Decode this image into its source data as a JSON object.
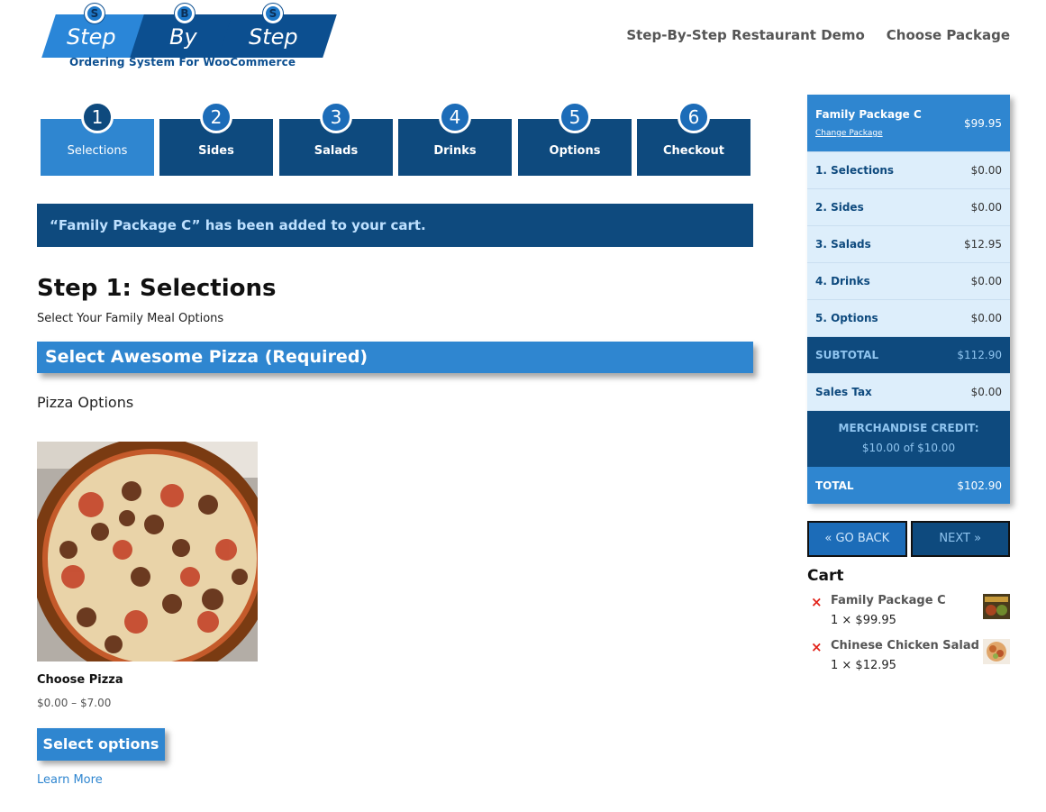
{
  "logo": {
    "badges": [
      "S",
      "B",
      "S"
    ],
    "words": [
      "Step",
      "By",
      "Step"
    ],
    "tagline": "Ordering System For WooCommerce"
  },
  "nav": {
    "items": [
      "Step-By-Step Restaurant Demo",
      "Choose Package"
    ]
  },
  "steps": [
    {
      "num": "1",
      "label": "Selections",
      "active": true
    },
    {
      "num": "2",
      "label": "Sides"
    },
    {
      "num": "3",
      "label": "Salads"
    },
    {
      "num": "4",
      "label": "Drinks"
    },
    {
      "num": "5",
      "label": "Options"
    },
    {
      "num": "6",
      "label": "Checkout"
    }
  ],
  "notice": "“Family Package C” has been added to your cart.",
  "page": {
    "title": "Step 1: Selections",
    "subtitle": "Select Your Family Meal Options"
  },
  "section": {
    "title": "Select Awesome Pizza (Required)",
    "options_label": "Pizza Options"
  },
  "product": {
    "name": "Choose Pizza",
    "price": "$0.00 – $7.00",
    "button": "Select options",
    "learn_more": "Learn More"
  },
  "summary": {
    "package_name": "Family Package C",
    "package_price": "$99.95",
    "change_link": "Change Package",
    "rows": [
      {
        "label": "1. Selections",
        "value": "$0.00"
      },
      {
        "label": "2. Sides",
        "value": "$0.00"
      },
      {
        "label": "3. Salads",
        "value": "$12.95"
      },
      {
        "label": "4. Drinks",
        "value": "$0.00"
      },
      {
        "label": "5. Options",
        "value": "$0.00"
      }
    ],
    "subtotal_label": "SUBTOTAL",
    "subtotal_value": "$112.90",
    "tax_label": "Sales Tax",
    "tax_value": "$0.00",
    "credit_label": "MERCHANDISE CREDIT:",
    "credit_value": "$10.00 of $10.00",
    "total_label": "TOTAL",
    "total_value": "$102.90"
  },
  "buttons": {
    "back": "« GO BACK",
    "next": "NEXT »"
  },
  "cart": {
    "title": "Cart",
    "remove_symbol": "×",
    "items": [
      {
        "name": "Family Package C",
        "qty": "1 × $99.95"
      },
      {
        "name": "Chinese Chicken Salad",
        "qty": "1 × $12.95"
      }
    ]
  },
  "colors": {
    "dark_blue": "#0e4a7e",
    "bright_blue": "#2f86d0",
    "light_panel": "#ddeefb",
    "remove_red": "#e2231a"
  }
}
